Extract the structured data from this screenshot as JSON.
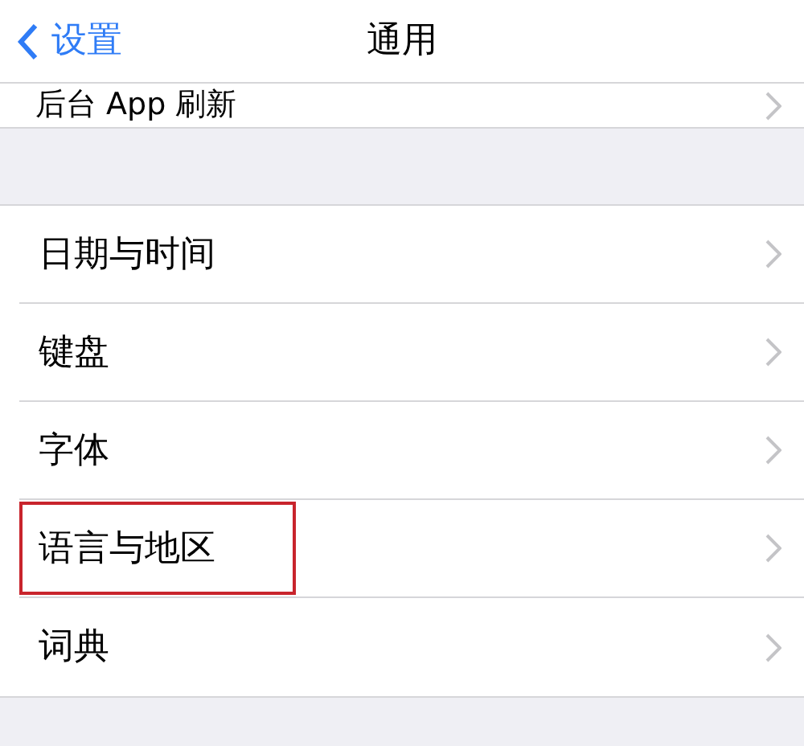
{
  "nav_bar": {
    "back_label": "设置",
    "title": "通用"
  },
  "top_row": {
    "label": "后台 App 刷新"
  },
  "items": [
    {
      "label": "日期与时间",
      "highlighted": false
    },
    {
      "label": "键盘",
      "highlighted": false
    },
    {
      "label": "字体",
      "highlighted": false
    },
    {
      "label": "语言与地区",
      "highlighted": true
    },
    {
      "label": "词典",
      "highlighted": false
    }
  ]
}
